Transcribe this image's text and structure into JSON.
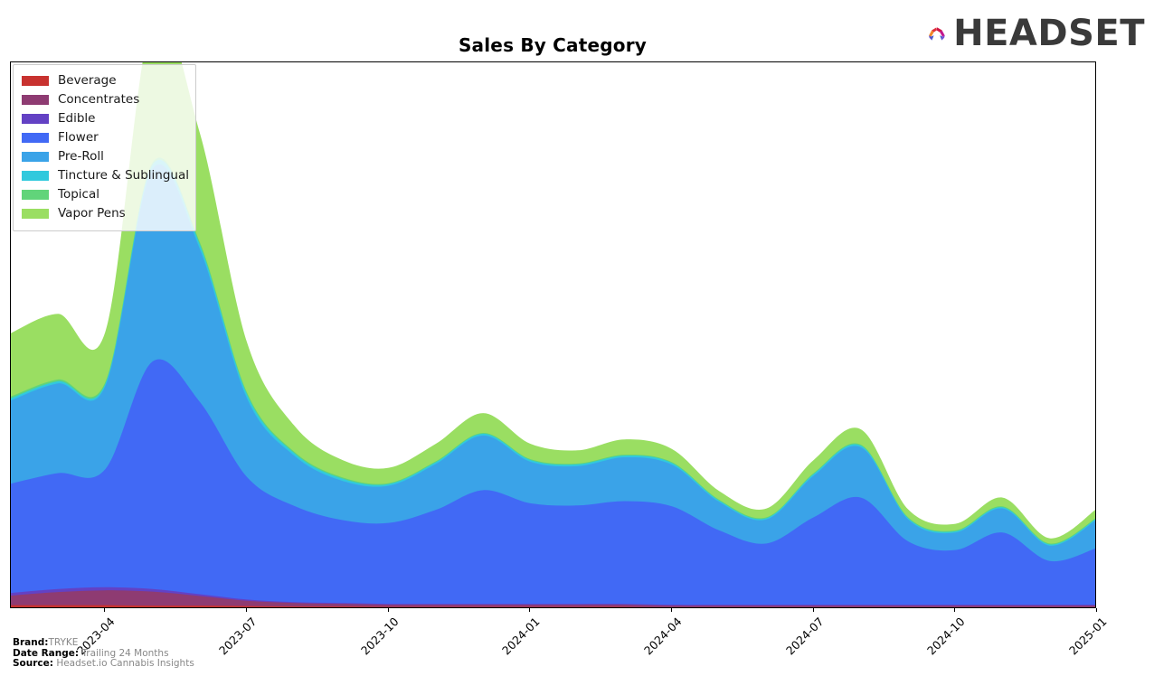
{
  "header": {
    "title": "Sales By Category",
    "logo_word": "HEADSET",
    "logo_colors": [
      "#f0872a",
      "#e0313c",
      "#c2178f",
      "#7b4fd8",
      "#3a4fd0"
    ]
  },
  "footer": {
    "brand_key": "Brand:",
    "brand_value": "TRYKE",
    "date_range_key": "Date Range:",
    "date_range_value": "Trailing 24 Months",
    "source_key": "Source:",
    "source_value": "Headset.io Cannabis Insights"
  },
  "legend": {
    "items": [
      {
        "label": "Beverage",
        "color": "#c8322f"
      },
      {
        "label": "Concentrates",
        "color": "#8e3b72"
      },
      {
        "label": "Edible",
        "color": "#6341c4"
      },
      {
        "label": "Flower",
        "color": "#4169f5"
      },
      {
        "label": "Pre-Roll",
        "color": "#3aa3e8"
      },
      {
        "label": "Tincture & Sublingual",
        "color": "#31c9dd"
      },
      {
        "label": "Topical",
        "color": "#61d47a"
      },
      {
        "label": "Vapor Pens",
        "color": "#9ade62"
      }
    ]
  },
  "chart_data": {
    "type": "area",
    "title": "Sales By Category",
    "xlabel": "",
    "ylabel": "",
    "stacked": true,
    "grid": false,
    "legend_position": "upper-left",
    "axis_ticks": [
      "2023-04",
      "2023-07",
      "2023-10",
      "2024-01",
      "2024-04",
      "2024-07",
      "2024-10",
      "2025-01"
    ],
    "x": [
      "2023-02",
      "2023-03",
      "2023-04",
      "2023-05",
      "2023-06",
      "2023-07",
      "2023-08",
      "2023-09",
      "2023-10",
      "2023-11",
      "2023-12",
      "2024-01",
      "2024-02",
      "2024-03",
      "2024-04",
      "2024-05",
      "2024-06",
      "2024-07",
      "2024-08",
      "2024-09",
      "2024-10",
      "2024-11",
      "2024-12",
      "2025-01"
    ],
    "series": [
      {
        "name": "Beverage",
        "color": "#c8322f",
        "values": [
          0.9,
          0.9,
          0.9,
          0.8,
          0.8,
          0.7,
          0.6,
          0.6,
          0.5,
          0.5,
          0.5,
          0.5,
          0.5,
          0.5,
          0.4,
          0.4,
          0.4,
          0.4,
          0.4,
          0.4,
          0.4,
          0.4,
          0.4,
          0.4
        ]
      },
      {
        "name": "Concentrates",
        "color": "#8e3b72",
        "values": [
          2.2,
          3.0,
          3.4,
          3.2,
          2.2,
          1.2,
          0.8,
          0.6,
          0.5,
          0.5,
          0.5,
          0.5,
          0.5,
          0.5,
          0.4,
          0.4,
          0.4,
          0.4,
          0.4,
          0.4,
          0.4,
          0.4,
          0.4,
          0.4
        ]
      },
      {
        "name": "Edible",
        "color": "#6341c4",
        "values": [
          0.6,
          0.7,
          0.7,
          0.6,
          0.4,
          0.3,
          0.2,
          0.2,
          0.2,
          0.2,
          0.2,
          0.2,
          0.2,
          0.2,
          0.2,
          0.2,
          0.2,
          0.2,
          0.2,
          0.2,
          0.2,
          0.2,
          0.2,
          0.2
        ]
      },
      {
        "name": "Flower",
        "color": "#4169f5",
        "values": [
          25.0,
          26.5,
          27.0,
          52.0,
          44.0,
          28.0,
          22.0,
          19.0,
          18.5,
          21.5,
          26.0,
          23.0,
          22.5,
          23.5,
          22.5,
          17.0,
          14.0,
          20.0,
          24.5,
          14.5,
          12.5,
          16.5,
          10.0,
          13.0
        ]
      },
      {
        "name": "Pre-Roll",
        "color": "#3aa3e8",
        "values": [
          19.0,
          20.5,
          19.0,
          44.0,
          35.0,
          18.0,
          11.5,
          9.0,
          8.5,
          10.5,
          12.5,
          9.5,
          9.0,
          10.0,
          9.5,
          6.5,
          5.5,
          9.5,
          11.5,
          5.0,
          4.0,
          5.5,
          3.5,
          6.5
        ]
      },
      {
        "name": "Tincture & Sublingual",
        "color": "#31c9dd",
        "values": [
          0.5,
          0.5,
          0.5,
          1.0,
          1.0,
          0.9,
          0.6,
          0.5,
          0.4,
          0.4,
          0.4,
          0.4,
          0.4,
          0.4,
          0.4,
          0.3,
          0.3,
          0.4,
          0.4,
          0.3,
          0.3,
          0.3,
          0.3,
          0.3
        ]
      },
      {
        "name": "Topical",
        "color": "#61d47a",
        "values": [
          0.4,
          0.4,
          0.4,
          0.5,
          0.5,
          0.4,
          0.3,
          0.3,
          0.2,
          0.2,
          0.2,
          0.2,
          0.2,
          0.2,
          0.2,
          0.2,
          0.2,
          0.2,
          0.2,
          0.2,
          0.2,
          0.2,
          0.2,
          0.2
        ]
      },
      {
        "name": "Vapor Pens",
        "color": "#9ade62",
        "values": [
          14.5,
          15.0,
          11.5,
          33.0,
          25.0,
          11.5,
          6.0,
          4.0,
          3.5,
          4.0,
          4.5,
          3.5,
          3.0,
          3.5,
          3.0,
          2.0,
          2.0,
          3.0,
          3.5,
          1.8,
          1.5,
          2.0,
          1.2,
          2.0
        ]
      }
    ],
    "ylim": [
      0,
      125
    ],
    "xlim": [
      "2023-02",
      "2025-01"
    ]
  }
}
